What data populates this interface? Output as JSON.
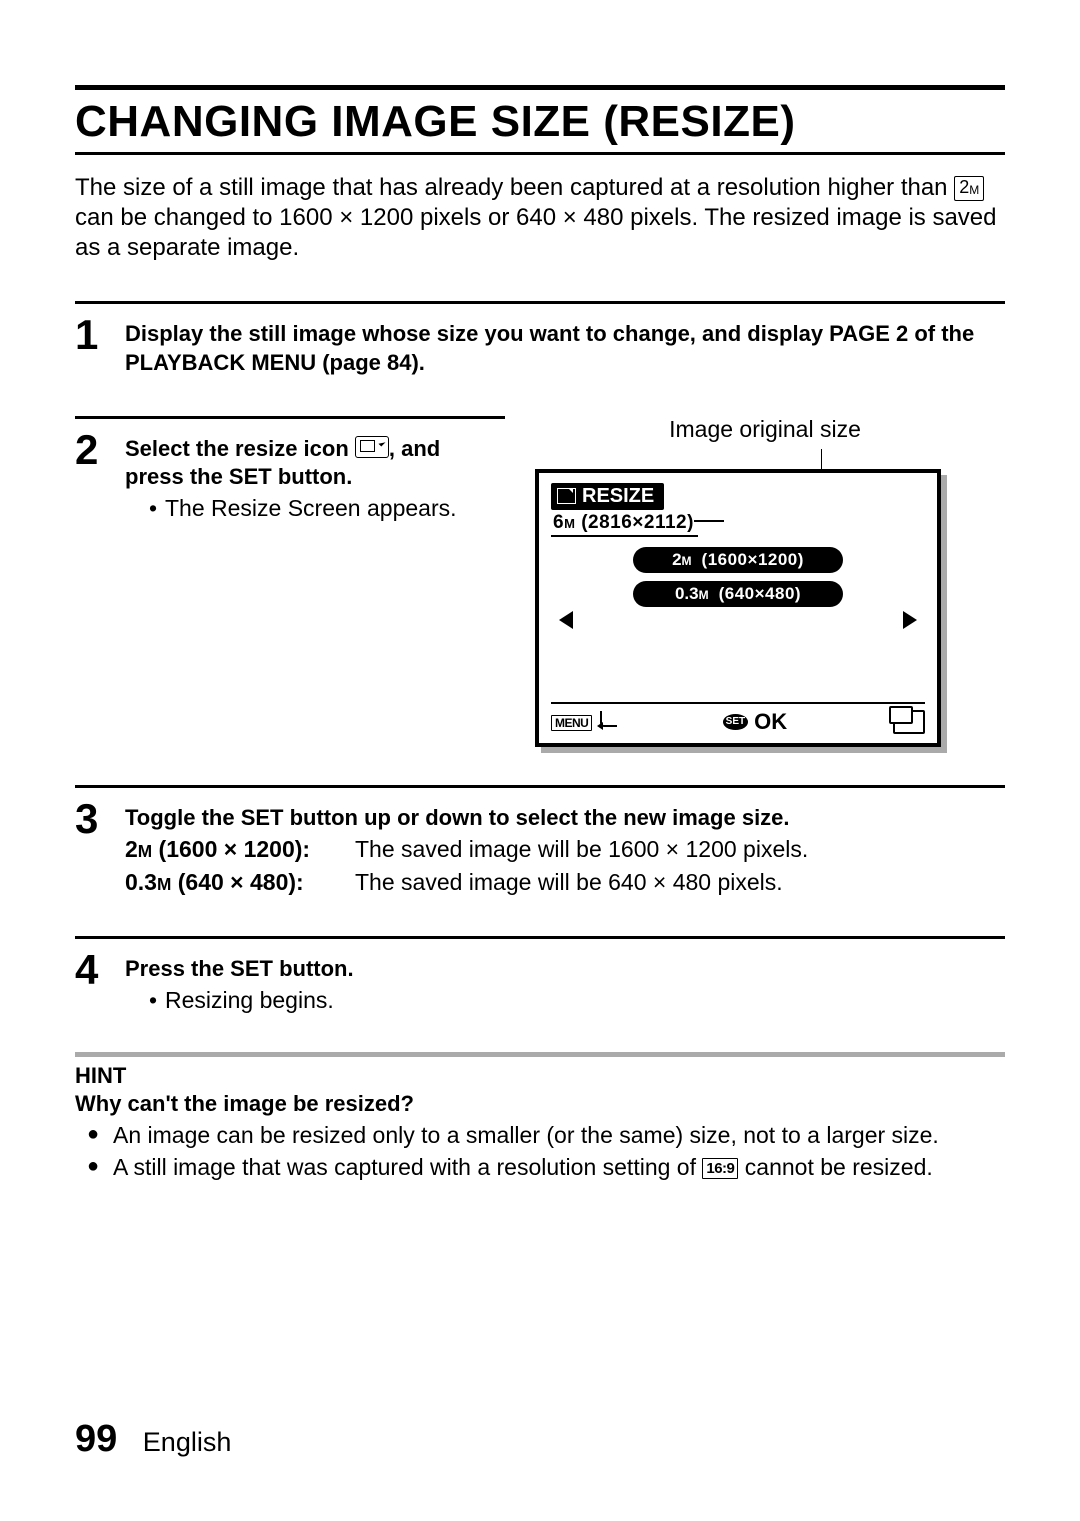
{
  "title": "CHANGING IMAGE SIZE (RESIZE)",
  "intro_part1": "The size of a still image that has already been captured at a resolution higher than ",
  "intro_inline_box_main": "2",
  "intro_inline_box_sub": "M",
  "intro_part2": " can be changed to 1600 × 1200 pixels or 640 × 480 pixels. The resized image is saved as a separate image.",
  "steps": {
    "s1": {
      "num": "1",
      "head": "Display the still image whose size you want to change, and display PAGE 2 of the PLAYBACK MENU (page 84)."
    },
    "s2": {
      "num": "2",
      "head_a": "Select the resize icon ",
      "head_b": ", and press the SET button.",
      "sub": "The Resize Screen appears."
    },
    "s3": {
      "num": "3",
      "head": "Toggle the SET button up or down to select the new image size.",
      "d1_term_a": "2",
      "d1_term_sub": "M",
      "d1_term_b": " (1600 × 1200):",
      "d1_desc": "The saved image will be 1600 × 1200 pixels.",
      "d2_term_a": "0.3",
      "d2_term_sub": "M",
      "d2_term_b": " (640 × 480):",
      "d2_desc": "The saved image will be 640 × 480 pixels."
    },
    "s4": {
      "num": "4",
      "head": "Press the SET button.",
      "sub": "Resizing begins."
    }
  },
  "figure": {
    "caption": "Image original size",
    "tab": "RESIZE",
    "orig_mp": "6",
    "orig_M": "M",
    "orig_dims": " (2816×2112)",
    "opt1_mp": "2",
    "opt1_M": "M",
    "opt1_dims": "(1600×1200)",
    "opt2_mp": "0.3",
    "opt2_M": "M",
    "opt2_dims": "(640×480)",
    "menu": "MENU",
    "set": "SET",
    "ok": "OK"
  },
  "hint": {
    "title": "HINT",
    "q": "Why can't the image be resized?",
    "li1": "An image can be resized only to a smaller (or the same) size, not to a larger size.",
    "li2a": "A still image that was captured with a resolution setting of ",
    "li2_box": "16:9",
    "li2b": " cannot be resized."
  },
  "footer": {
    "page": "99",
    "lang": "English"
  }
}
